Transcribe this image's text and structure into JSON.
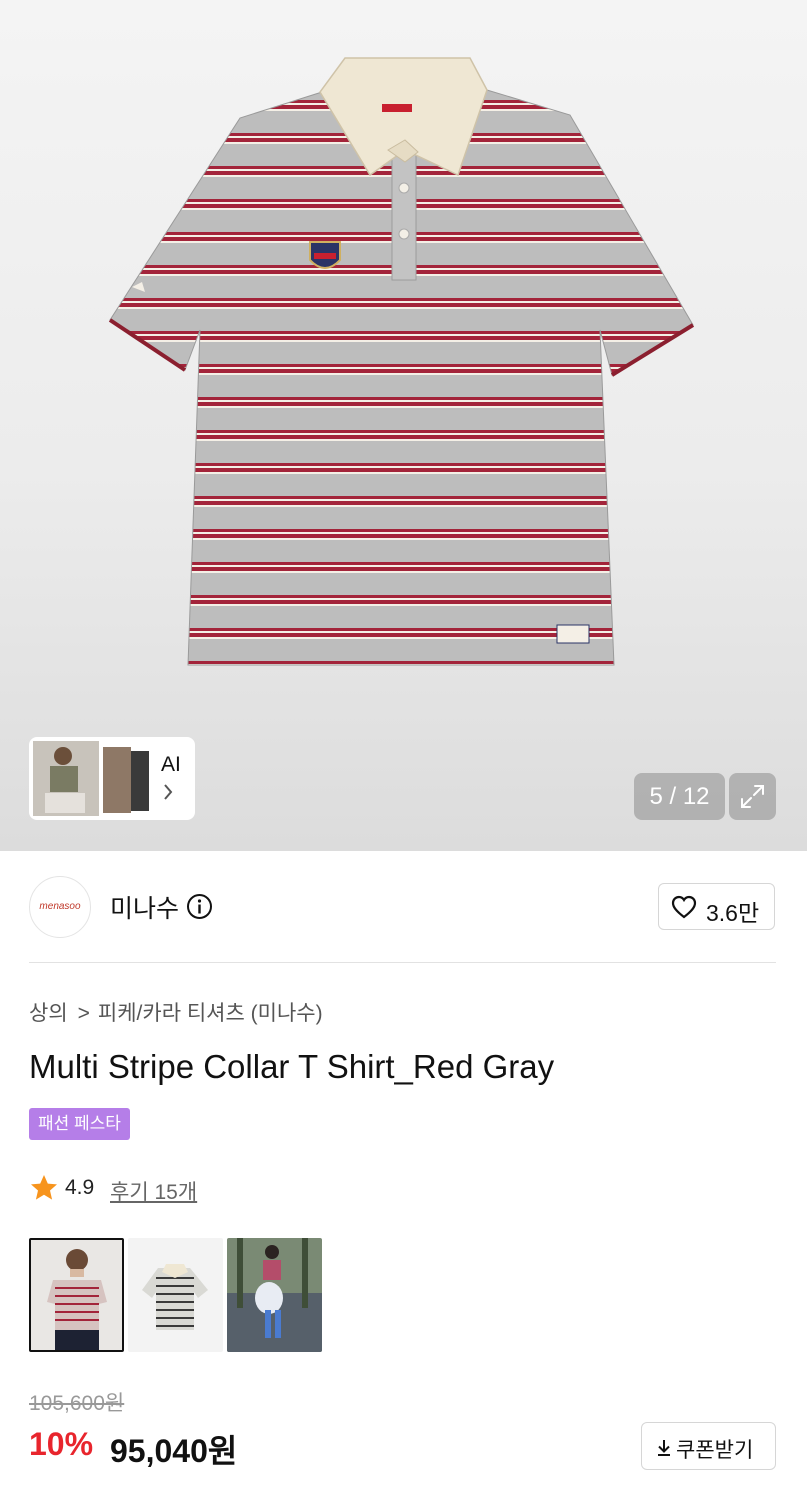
{
  "gallery": {
    "counter": "5 / 12",
    "ai_label": "AI",
    "main_image": "striped-polo-shirt"
  },
  "brand": {
    "logo_text": "menasoo",
    "name": "미나수",
    "like_count": "3.6만"
  },
  "product": {
    "breadcrumb": [
      "상의",
      "피케/카라 티셔츠 (미나수)"
    ],
    "title": "Multi Stripe Collar T Shirt_Red Gray",
    "badge": "패션 페스타",
    "rating": "4.9",
    "reviews": "후기 15개"
  },
  "price": {
    "original": "105,600원",
    "discount": "10%",
    "final": "95,040원",
    "coupon_label": "쿠폰받기"
  },
  "colors": {
    "accent_red": "#e8252d",
    "badge_purple": "#b57ee8",
    "stripe_red": "#a3243a",
    "star_orange": "#f7941d"
  },
  "icons": {
    "info": "info-icon",
    "like": "heart-icon",
    "rating": "star-icon",
    "expand": "expand-icon",
    "chevron": "chevron-right-icon",
    "download": "download-icon"
  }
}
